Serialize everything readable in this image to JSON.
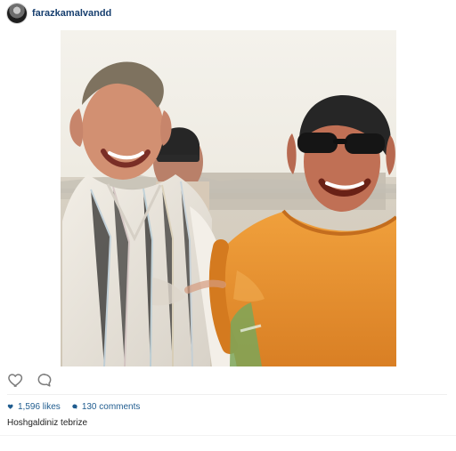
{
  "post": {
    "username": "farazkamalvandd",
    "likes": "1,596 likes",
    "comments": "130 comments",
    "caption": "Hoshgaldiniz tebrize"
  },
  "icons": {
    "avatar": "profile-avatar",
    "like": "heart-icon",
    "comment": "comment-icon",
    "likes_small": "small-heart-icon",
    "comments_small": "small-comment-icon"
  },
  "colors": {
    "username": "#173f6f",
    "link_blue": "#1f5c8f",
    "divider": "#efefef",
    "photo_sky": "#ebe7de"
  }
}
